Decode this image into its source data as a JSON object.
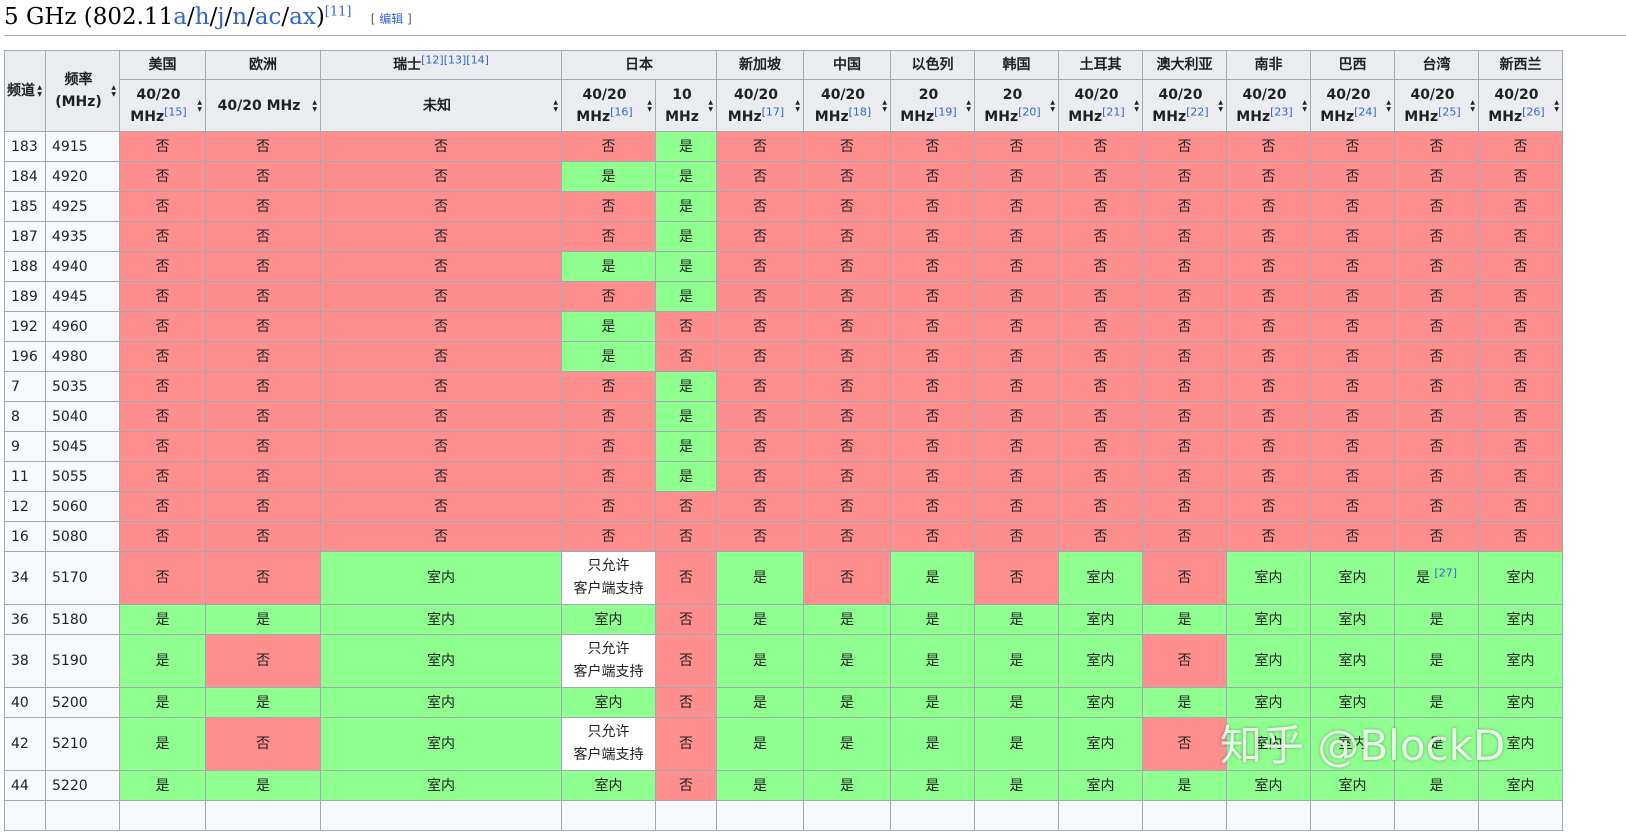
{
  "heading": {
    "prefix": "5 GHz (802.11",
    "links": [
      "a",
      "h",
      "j",
      "n",
      "ac",
      "ax"
    ],
    "ref": "[11]",
    "edit_open": "[ ",
    "edit_label": "编辑",
    "edit_close": " ]"
  },
  "columns": {
    "channel": "频道",
    "freq": "频率 (MHz)",
    "regions": [
      "美国",
      "欧洲",
      "瑞士",
      "日本",
      "新加坡",
      "中国",
      "以色列",
      "韩国",
      "土耳其",
      "澳大利亚",
      "南非",
      "巴西",
      "台湾",
      "新西兰"
    ],
    "region_refs": [
      "",
      "",
      "[12][13][14]",
      "",
      "",
      "",
      "",
      "",
      "",
      "",
      "",
      "",
      "",
      ""
    ],
    "sub": [
      {
        "label": "40/20 MHz",
        "ref": "[15]"
      },
      {
        "label": "40/20 MHz",
        "ref": ""
      },
      {
        "label": "未知",
        "ref": ""
      },
      {
        "label": "40/20 MHz",
        "ref": "[16]"
      },
      {
        "label": "10 MHz",
        "ref": ""
      },
      {
        "label": "40/20 MHz",
        "ref": "[17]"
      },
      {
        "label": "40/20 MHz",
        "ref": "[18]"
      },
      {
        "label": "20 MHz",
        "ref": "[19]"
      },
      {
        "label": "20 MHz",
        "ref": "[20]"
      },
      {
        "label": "40/20 MHz",
        "ref": "[21]"
      },
      {
        "label": "40/20 MHz",
        "ref": "[22]"
      },
      {
        "label": "40/20 MHz",
        "ref": "[23]"
      },
      {
        "label": "40/20 MHz",
        "ref": "[24]"
      },
      {
        "label": "40/20 MHz",
        "ref": "[25]"
      },
      {
        "label": "40/20 MHz",
        "ref": "[26]"
      }
    ]
  },
  "rows": [
    {
      "ch": "183",
      "f": "4915",
      "cells": [
        "否",
        "否",
        "否",
        "否",
        "是",
        "否",
        "否",
        "否",
        "否",
        "否",
        "否",
        "否",
        "否",
        "否",
        "否"
      ]
    },
    {
      "ch": "184",
      "f": "4920",
      "cells": [
        "否",
        "否",
        "否",
        "是",
        "是",
        "否",
        "否",
        "否",
        "否",
        "否",
        "否",
        "否",
        "否",
        "否",
        "否"
      ]
    },
    {
      "ch": "185",
      "f": "4925",
      "cells": [
        "否",
        "否",
        "否",
        "否",
        "是",
        "否",
        "否",
        "否",
        "否",
        "否",
        "否",
        "否",
        "否",
        "否",
        "否"
      ]
    },
    {
      "ch": "187",
      "f": "4935",
      "cells": [
        "否",
        "否",
        "否",
        "否",
        "是",
        "否",
        "否",
        "否",
        "否",
        "否",
        "否",
        "否",
        "否",
        "否",
        "否"
      ]
    },
    {
      "ch": "188",
      "f": "4940",
      "cells": [
        "否",
        "否",
        "否",
        "是",
        "是",
        "否",
        "否",
        "否",
        "否",
        "否",
        "否",
        "否",
        "否",
        "否",
        "否"
      ]
    },
    {
      "ch": "189",
      "f": "4945",
      "cells": [
        "否",
        "否",
        "否",
        "否",
        "是",
        "否",
        "否",
        "否",
        "否",
        "否",
        "否",
        "否",
        "否",
        "否",
        "否"
      ]
    },
    {
      "ch": "192",
      "f": "4960",
      "cells": [
        "否",
        "否",
        "否",
        "是",
        "否",
        "否",
        "否",
        "否",
        "否",
        "否",
        "否",
        "否",
        "否",
        "否",
        "否"
      ]
    },
    {
      "ch": "196",
      "f": "4980",
      "cells": [
        "否",
        "否",
        "否",
        "是",
        "否",
        "否",
        "否",
        "否",
        "否",
        "否",
        "否",
        "否",
        "否",
        "否",
        "否"
      ]
    },
    {
      "ch": "7",
      "f": "5035",
      "cells": [
        "否",
        "否",
        "否",
        "否",
        "是",
        "否",
        "否",
        "否",
        "否",
        "否",
        "否",
        "否",
        "否",
        "否",
        "否"
      ]
    },
    {
      "ch": "8",
      "f": "5040",
      "cells": [
        "否",
        "否",
        "否",
        "否",
        "是",
        "否",
        "否",
        "否",
        "否",
        "否",
        "否",
        "否",
        "否",
        "否",
        "否"
      ]
    },
    {
      "ch": "9",
      "f": "5045",
      "cells": [
        "否",
        "否",
        "否",
        "否",
        "是",
        "否",
        "否",
        "否",
        "否",
        "否",
        "否",
        "否",
        "否",
        "否",
        "否"
      ]
    },
    {
      "ch": "11",
      "f": "5055",
      "cells": [
        "否",
        "否",
        "否",
        "否",
        "是",
        "否",
        "否",
        "否",
        "否",
        "否",
        "否",
        "否",
        "否",
        "否",
        "否"
      ]
    },
    {
      "ch": "12",
      "f": "5060",
      "cells": [
        "否",
        "否",
        "否",
        "否",
        "否",
        "否",
        "否",
        "否",
        "否",
        "否",
        "否",
        "否",
        "否",
        "否",
        "否"
      ]
    },
    {
      "ch": "16",
      "f": "5080",
      "cells": [
        "否",
        "否",
        "否",
        "否",
        "否",
        "否",
        "否",
        "否",
        "否",
        "否",
        "否",
        "否",
        "否",
        "否",
        "否"
      ]
    },
    {
      "ch": "34",
      "f": "5170",
      "tall": true,
      "cells": [
        "否",
        "否",
        "室内",
        "只允许\n客户端支持",
        "否",
        "是",
        "否",
        "是",
        "否",
        "室内",
        "否",
        "室内",
        "室内",
        "是 [27]",
        "室内"
      ]
    },
    {
      "ch": "36",
      "f": "5180",
      "cells": [
        "是",
        "是",
        "室内",
        "室内",
        "否",
        "是",
        "是",
        "是",
        "是",
        "室内",
        "是",
        "室内",
        "室内",
        "是",
        "室内"
      ]
    },
    {
      "ch": "38",
      "f": "5190",
      "tall": true,
      "cells": [
        "是",
        "否",
        "室内",
        "只允许\n客户端支持",
        "否",
        "是",
        "是",
        "是",
        "是",
        "室内",
        "否",
        "室内",
        "室内",
        "是",
        "室内"
      ]
    },
    {
      "ch": "40",
      "f": "5200",
      "cells": [
        "是",
        "是",
        "室内",
        "室内",
        "否",
        "是",
        "是",
        "是",
        "是",
        "室内",
        "是",
        "室内",
        "室内",
        "是",
        "室内"
      ]
    },
    {
      "ch": "42",
      "f": "5210",
      "tall": true,
      "cells": [
        "是",
        "否",
        "室内",
        "只允许\n客户端支持",
        "否",
        "是",
        "是",
        "是",
        "是",
        "室内",
        "否",
        "室内",
        "室内",
        "是",
        "室内"
      ]
    },
    {
      "ch": "44",
      "f": "5220",
      "cells": [
        "是",
        "是",
        "室内",
        "室内",
        "否",
        "是",
        "是",
        "是",
        "是",
        "室内",
        "是",
        "室内",
        "室内",
        "是",
        "室内"
      ]
    },
    {
      "ch": "",
      "f": "",
      "cells": [
        "",
        "",
        "",
        "",
        "",
        "",
        "",
        "",
        "",
        "",
        "",
        "",
        "",
        "",
        ""
      ]
    }
  ],
  "watermark": "知乎 @BlockD",
  "colors": {
    "no": "#ff8f8f",
    "yes": "#8fff8f",
    "header": "#eaecf0",
    "link": "#3366cc"
  }
}
